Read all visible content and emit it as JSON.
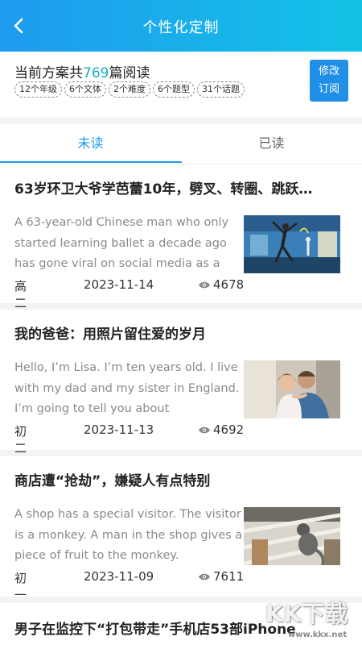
{
  "header": {
    "title": "个性化定制",
    "back_icon": "chevron-left-icon"
  },
  "plan": {
    "summary_prefix": "当前方案共",
    "article_count": "769",
    "summary_suffix": "篇阅读",
    "tags": [
      "12个年级",
      "6个文体",
      "2个难度",
      "6个题型",
      "31个话题"
    ],
    "modify_line1": "修改",
    "modify_line2": "订阅"
  },
  "tabs": [
    {
      "label": "未读",
      "active": true
    },
    {
      "label": "已读",
      "active": false
    }
  ],
  "articles": [
    {
      "title": "63岁环卫大爷学芭蕾10年，劈叉、转圈、跳跃…",
      "excerpt": "A 63-year-old Chinese man who only started learning ballet a decade ago has gone viral on social media as a",
      "grade": "高二",
      "date": "2023-11-14",
      "views": "4678"
    },
    {
      "title": "我的爸爸：用照片留住爱的岁月",
      "excerpt": "Hello, I’m Lisa. I’m ten years old. I live with my dad and my sister in England. I’m going to tell you about",
      "grade": "初二",
      "date": "2023-11-13",
      "views": "4692"
    },
    {
      "title": "商店遭“抢劫”，嫌疑人有点特别",
      "excerpt": "A shop has a special visitor. The visitor is a monkey. A man in the shop gives a piece of fruit to the monkey.",
      "grade": "初一",
      "date": "2023-11-09",
      "views": "7611"
    },
    {
      "title": "男子在监控下“打包带走”手机店53部iPhone",
      "excerpt": "",
      "grade": "",
      "date": "",
      "views": ""
    }
  ],
  "watermark": {
    "text": "KK下载",
    "url": "www.kkx.net"
  },
  "colors": {
    "header_start": "#1f9bef",
    "header_end": "#13c2e6",
    "accent": "#1e9bf0",
    "count": "#16b0c0",
    "button": "#1f8fe8"
  }
}
